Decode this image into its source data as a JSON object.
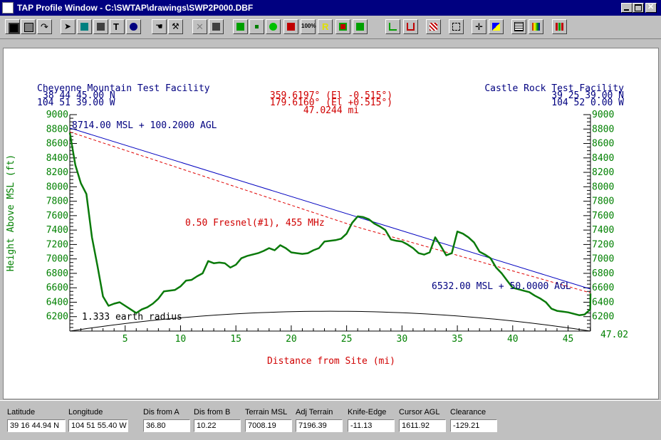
{
  "window": {
    "title": "TAP Profile Window - C:\\SWTAP\\drawings\\SWP2P000.DBF"
  },
  "toolbar_icons": [
    "save-icon",
    "print-icon",
    "redo-arrow-icon",
    "pointer-icon",
    "fill-icon",
    "export-icon",
    "text-tool-icon",
    "info-icon",
    "hand-icon",
    "wrench-icon",
    "cross-icon",
    "import-icon",
    "green-square-icon",
    "green-dot-icon",
    "pen-icon",
    "red-x-icon",
    "zoom-100-icon",
    "letter-r-icon",
    "swap-icon",
    "diagonal-icon",
    "profile-line-icon",
    "profile-area-icon",
    "hatch-icon",
    "select-box-icon",
    "move-cross-icon",
    "color-squares-icon",
    "grid-icon",
    "color-grid-icon",
    "bar-chart-icon"
  ],
  "toolbar_labels": {
    "zoom": "100%",
    "r": "R"
  },
  "profile": {
    "site_a_name": "Cheyenne Mountain Test Facility",
    "site_a_lat": "38 44 45.00 N",
    "site_a_lon": "104 51 39.00 W",
    "site_b_name": "Castle Rock Test Facility",
    "site_b_lat": "39 25 39.00 N",
    "site_b_lon": "104 52 0.00 W",
    "azimuth_a": "359.6197° (El -0.515°)",
    "azimuth_b": "179.6160° (El +0.515°)",
    "distance": "47.0244 mi",
    "antenna_a": "8714.00 MSL + 100.2000 AGL",
    "antenna_b": "6532.00 MSL + 50.0000 AGL",
    "fresnel_label": "0.50 Fresnel(#1), 455 MHz",
    "earth_label": "1.333 earth radius",
    "end_distance_label": "47.02",
    "ylabel": "Height Above MSL (ft)",
    "xlabel": "Distance from Site (mi)"
  },
  "chart_data": {
    "type": "line",
    "xlabel": "Distance from Site (mi)",
    "ylabel": "Height Above MSL (ft)",
    "xlim": [
      0,
      47.0244
    ],
    "ylim": [
      6000,
      9000
    ],
    "x_ticks": [
      5,
      10,
      15,
      20,
      25,
      30,
      35,
      40,
      45
    ],
    "y_ticks": [
      6200,
      6400,
      6600,
      6800,
      7000,
      7200,
      7400,
      7600,
      7800,
      8000,
      8200,
      8400,
      8600,
      8800,
      9000
    ],
    "colors": {
      "terrain": "#0a7a0a",
      "line_of_sight": "#0000c0",
      "fresnel": "#e00000",
      "earth": "#000000",
      "axes": "#008000",
      "labels_a": "#000080",
      "labels_mid": "#d00000"
    },
    "series": [
      {
        "name": "",
        "x": [
          0,
          0.5,
          1,
          1.5,
          2,
          2.5,
          3,
          3.5,
          4,
          4.5,
          5,
          5.5,
          6,
          6.5,
          7,
          7.5,
          8,
          8.5,
          9,
          9.5,
          10,
          10.5,
          11,
          11.5,
          12,
          12.5,
          13,
          13.5,
          14,
          14.5,
          15,
          15.5,
          16,
          16.5,
          17,
          17.5,
          18,
          18.5,
          19,
          19.5,
          20,
          20.5,
          21,
          21.5,
          22,
          22.5,
          23,
          23.5,
          24,
          24.5,
          25,
          25.5,
          26,
          26.5,
          27,
          27.5,
          28,
          28.5,
          29,
          29.5,
          30,
          30.5,
          31,
          31.5,
          32,
          32.5,
          33,
          33.5,
          34,
          34.5,
          35,
          35.5,
          36,
          36.5,
          37,
          37.5,
          38,
          38.5,
          39,
          39.5,
          40,
          40.5,
          41,
          41.5,
          42,
          42.5,
          43,
          43.5,
          44,
          44.5,
          45,
          45.5,
          46,
          46.5,
          47,
          47.0244
        ],
        "y": [
          8750,
          8300,
          8050,
          7900,
          7300,
          6900,
          6480,
          6350,
          6380,
          6400,
          6350,
          6300,
          6250,
          6300,
          6330,
          6380,
          6450,
          6550,
          6560,
          6570,
          6620,
          6700,
          6710,
          6760,
          6800,
          6970,
          6940,
          6950,
          6940,
          6880,
          6920,
          7010,
          7040,
          7060,
          7080,
          7110,
          7150,
          7120,
          7190,
          7150,
          7090,
          7080,
          7070,
          7080,
          7120,
          7150,
          7240,
          7250,
          7260,
          7280,
          7350,
          7500,
          7590,
          7580,
          7550,
          7490,
          7450,
          7400,
          7270,
          7250,
          7240,
          7200,
          7150,
          7080,
          7060,
          7090,
          7300,
          7180,
          7050,
          7080,
          7380,
          7350,
          7300,
          7230,
          7100,
          7060,
          7010,
          6880,
          6800,
          6700,
          6600,
          6580,
          6560,
          6540,
          6490,
          6450,
          6400,
          6310,
          6280,
          6270,
          6260,
          6240,
          6220,
          6230,
          6300,
          6520
        ]
      },
      {
        "name": "",
        "x": [
          0,
          47.0244
        ],
        "y": [
          8814.2,
          6582
        ]
      },
      {
        "name": "",
        "x": [
          0,
          26,
          47.0244
        ],
        "y": [
          8760,
          7440,
          6530
        ]
      },
      {
        "name": "",
        "x": [
          0,
          5,
          10,
          15,
          20,
          23.5,
          27,
          32,
          37,
          42,
          47.0244
        ],
        "y": [
          6000,
          6120,
          6200,
          6250,
          6270,
          6275,
          6270,
          6250,
          6200,
          6120,
          6000
        ]
      }
    ]
  },
  "status": {
    "latitude_label": "Latitude",
    "latitude_value": "39 16 44.94 N",
    "longitude_label": "Longitude",
    "longitude_value": "104 51 55.40 W",
    "dis_a_label": "Dis from A",
    "dis_a_value": "36.80",
    "dis_b_label": "Dis from B",
    "dis_b_value": "10.22",
    "terrain_label": "Terrain MSL",
    "terrain_value": "7008.19",
    "adj_terrain_label": "Adj Terrain",
    "adj_terrain_value": "7196.39",
    "knife_label": "Knife-Edge",
    "knife_value": "-11.13",
    "cursor_agl_label": "Cursor AGL",
    "cursor_agl_value": "1611.92",
    "clearance_label": "Clearance",
    "clearance_value": "-129.21"
  }
}
